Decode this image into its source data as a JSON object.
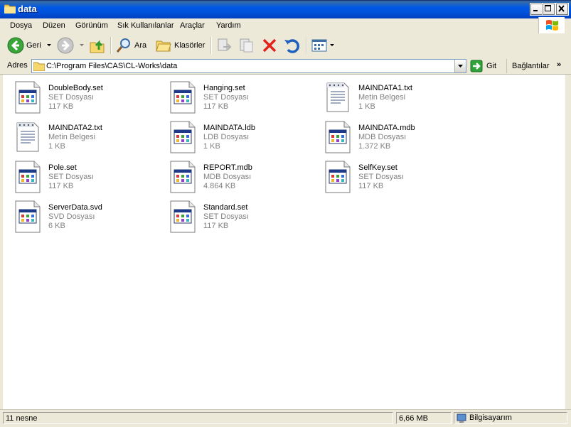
{
  "window": {
    "title": "data",
    "icon": "folder-icon"
  },
  "menu": [
    "Dosya",
    "Düzen",
    "Görünüm",
    "Sık Kullanılanlar",
    "Araçlar",
    "Yardım"
  ],
  "toolbar": {
    "back_label": "Geri",
    "search_label": "Ara",
    "folders_label": "Klasörler"
  },
  "address": {
    "label": "Adres",
    "path": "C:\\Program Files\\CAS\\CL-Works\\data",
    "go_label": "Git",
    "links_label": "Bağlantılar",
    "chevron": "»"
  },
  "files": [
    {
      "name": "DoubleBody.set",
      "type": "SET Dosyası",
      "size": "117 KB",
      "icon": "app-file-icon"
    },
    {
      "name": "Hanging.set",
      "type": "SET Dosyası",
      "size": "117 KB",
      "icon": "app-file-icon"
    },
    {
      "name": "MAINDATA1.txt",
      "type": "Metin Belgesi",
      "size": "1 KB",
      "icon": "text-document-icon"
    },
    {
      "name": "MAINDATA2.txt",
      "type": "Metin Belgesi",
      "size": "1 KB",
      "icon": "text-document-icon"
    },
    {
      "name": "MAINDATA.ldb",
      "type": "LDB Dosyası",
      "size": "1 KB",
      "icon": "app-file-icon"
    },
    {
      "name": "MAINDATA.mdb",
      "type": "MDB Dosyası",
      "size": "1.372 KB",
      "icon": "app-file-icon"
    },
    {
      "name": "Pole.set",
      "type": "SET Dosyası",
      "size": "117 KB",
      "icon": "app-file-icon"
    },
    {
      "name": "REPORT.mdb",
      "type": "MDB Dosyası",
      "size": "4.864 KB",
      "icon": "app-file-icon"
    },
    {
      "name": "SelfKey.set",
      "type": "SET Dosyası",
      "size": "117 KB",
      "icon": "app-file-icon"
    },
    {
      "name": "ServerData.svd",
      "type": "SVD Dosyası",
      "size": "6 KB",
      "icon": "app-file-icon"
    },
    {
      "name": "Standard.set",
      "type": "SET Dosyası",
      "size": "117 KB",
      "icon": "app-file-icon"
    }
  ],
  "status": {
    "count": "11 nesne",
    "size": "6,66 MB",
    "location": "Bilgisayarım"
  },
  "colors": {
    "titlebar": "#0058e6",
    "chrome": "#ece9d8",
    "close_red": "#e0241c",
    "go_green": "#2fa33a"
  }
}
